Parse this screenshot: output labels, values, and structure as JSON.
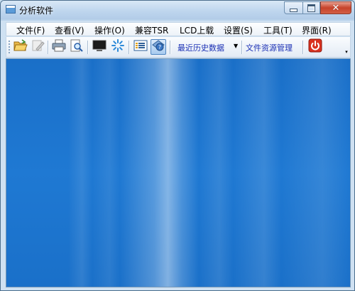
{
  "window": {
    "title": "分析软件"
  },
  "window_controls": {
    "close_symbol": "✕"
  },
  "menu": {
    "items": [
      "文件(F)",
      "查看(V)",
      "操作(O)",
      "兼容TSR",
      "LCD上载",
      "设置(S)",
      "工具(T)",
      "界面(R)"
    ]
  },
  "toolbar": {
    "icons": [
      "open-folder-icon",
      "edit-icon",
      "print-icon",
      "print-preview-icon",
      "monitor-icon",
      "loading-icon",
      "list-icon",
      "help-icon",
      "power-icon"
    ],
    "recent_data_label": "最近历史数据",
    "file_manager_label": "文件资源管理"
  },
  "colors": {
    "content_background": "#1f79d3",
    "toolbar_link": "#1a2fb4",
    "close_button": "#c7432b",
    "power_button": "#d9311f"
  }
}
